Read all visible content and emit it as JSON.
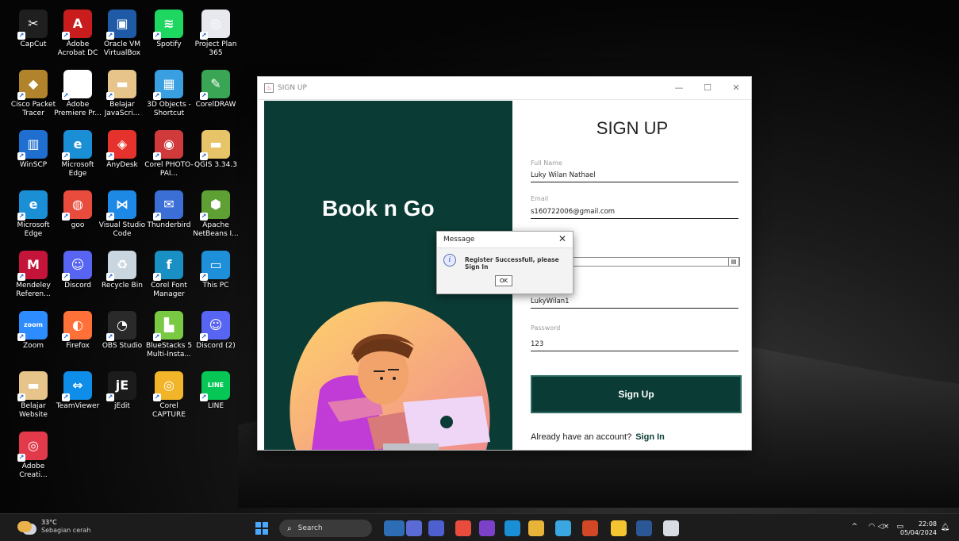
{
  "desktop": {
    "icons": [
      {
        "label": "CapCut",
        "color": "#1f1f1f",
        "glyph": "✂"
      },
      {
        "label": "Adobe Acrobat DC",
        "color": "#c91d1d",
        "glyph": "A"
      },
      {
        "label": "Oracle VM VirtualBox",
        "color": "#1f5aa6",
        "glyph": "▣"
      },
      {
        "label": "Spotify",
        "color": "#1ed760",
        "glyph": "≋"
      },
      {
        "label": "Project Plan 365",
        "color": "#e8e8ef",
        "glyph": "◎"
      },
      {
        "label": "Cisco Packet Tracer",
        "color": "#b1842c",
        "glyph": "◆"
      },
      {
        "label": "Adobe Premiere Pr...",
        "color": "#ffffff",
        "glyph": ""
      },
      {
        "label": "Belajar JavaScri...",
        "color": "#e6c48a",
        "glyph": "▬"
      },
      {
        "label": "3D Objects - Shortcut",
        "color": "#3a9fe0",
        "glyph": "▦"
      },
      {
        "label": "CorelDRAW",
        "color": "#3aa655",
        "glyph": "✎"
      },
      {
        "label": "WinSCP",
        "color": "#1f6fd1",
        "glyph": "▥"
      },
      {
        "label": "Microsoft Edge",
        "color": "#1b8fd6",
        "glyph": "e"
      },
      {
        "label": "AnyDesk",
        "color": "#e6322c",
        "glyph": "◈"
      },
      {
        "label": "Corel PHOTO-PAI...",
        "color": "#d03a3a",
        "glyph": "◉"
      },
      {
        "label": "QGIS 3.34.3",
        "color": "#e8c469",
        "glyph": "▬"
      },
      {
        "label": "Microsoft Edge",
        "color": "#1b8fd6",
        "glyph": "e"
      },
      {
        "label": "goo",
        "color": "#e94c3d",
        "glyph": "◍"
      },
      {
        "label": "Visual Studio Code",
        "color": "#1e88e5",
        "glyph": "⋈"
      },
      {
        "label": "Thunderbird",
        "color": "#3b6fd6",
        "glyph": "✉"
      },
      {
        "label": "Apache NetBeans I...",
        "color": "#5fa035",
        "glyph": "⬢"
      },
      {
        "label": "Mendeley Referen...",
        "color": "#c4143a",
        "glyph": "M"
      },
      {
        "label": "Discord",
        "color": "#5865f2",
        "glyph": "☺"
      },
      {
        "label": "Recycle Bin",
        "color": "#c9d6df",
        "glyph": "♻"
      },
      {
        "label": "Corel Font Manager",
        "color": "#1a8fc4",
        "glyph": "f"
      },
      {
        "label": "This PC",
        "color": "#1e90d9",
        "glyph": "▭"
      },
      {
        "label": "Zoom",
        "color": "#2d8cff",
        "glyph": "zoom"
      },
      {
        "label": "Firefox",
        "color": "#ff7139",
        "glyph": "◐"
      },
      {
        "label": "OBS Studio",
        "color": "#2a2a2a",
        "glyph": "◔"
      },
      {
        "label": "BlueStacks 5 Multi-Insta...",
        "color": "#7ac943",
        "glyph": "▙"
      },
      {
        "label": "Discord (2)",
        "color": "#5865f2",
        "glyph": "☺"
      },
      {
        "label": "Belajar Website",
        "color": "#e6c48a",
        "glyph": "▬"
      },
      {
        "label": "TeamViewer",
        "color": "#0e8ee9",
        "glyph": "⇔"
      },
      {
        "label": "jEdit",
        "color": "#1c1c1c",
        "glyph": "jE"
      },
      {
        "label": "Corel CAPTURE",
        "color": "#f2b429",
        "glyph": "◎"
      },
      {
        "label": "LINE",
        "color": "#06c755",
        "glyph": "LINE"
      },
      {
        "label": "Adobe Creati...",
        "color": "#e23a4a",
        "glyph": "◎"
      }
    ]
  },
  "window": {
    "title": "SIGN UP",
    "controls": {
      "minimize": "—",
      "maximize": "☐",
      "close": "✕"
    },
    "brand": "Book n Go",
    "form": {
      "title": "SIGN UP",
      "full_name_label": "Full Name",
      "full_name_value": "Luky Wilan Nathael",
      "email_label": "Email",
      "email_value": "s160722006@gmail.com",
      "username_value": "LukyWilan1",
      "password_label": "Password",
      "password_value": "123",
      "signup_button": "Sign Up",
      "already_text": "Already have an account?",
      "signin_link": "Sign In"
    }
  },
  "dialog": {
    "title": "Message",
    "close": "✕",
    "info_glyph": "i",
    "message": "Register Successfull, please Sign In",
    "ok": "OK"
  },
  "taskbar": {
    "weather_temp": "33°C",
    "weather_desc": "Sebagian cerah",
    "search_label": "Search",
    "time": "22:08",
    "date": "05/04/2024",
    "tray_up": "^",
    "tray_wifi": "◠",
    "tray_volume": "◁×",
    "tray_battery": "▭",
    "pinned": [
      {
        "name": "widget-app",
        "color": "#2d6db5"
      },
      {
        "name": "teams-app",
        "color": "#5b6bd6"
      },
      {
        "name": "teams-chat",
        "color": "#4e5fd0"
      },
      {
        "name": "chrome-app",
        "color": "#e94c3d"
      },
      {
        "name": "vs-app",
        "color": "#7b42c9"
      },
      {
        "name": "edge-app",
        "color": "#1b8fd6"
      },
      {
        "name": "explorer-app",
        "color": "#e8b339"
      },
      {
        "name": "photos-app",
        "color": "#3aa7e0"
      },
      {
        "name": "powerpoint-app",
        "color": "#d24726"
      },
      {
        "name": "store-app",
        "color": "#f5c531"
      },
      {
        "name": "word-app",
        "color": "#2b5797"
      },
      {
        "name": "java-app",
        "color": "#d8dde4"
      }
    ]
  }
}
